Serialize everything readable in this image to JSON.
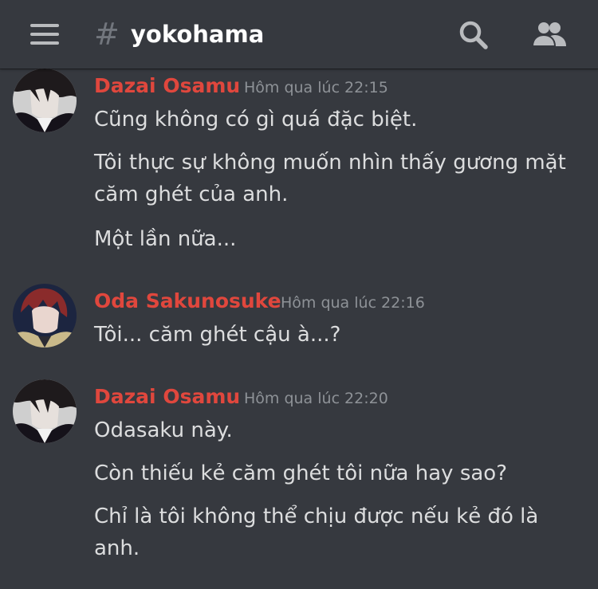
{
  "header": {
    "menu_icon": "hamburger-menu-icon",
    "hash_symbol": "#",
    "channel_name": "yokohama",
    "search_icon": "search-icon",
    "members_icon": "members-icon"
  },
  "colors": {
    "background": "#36393f",
    "username": "#e0473d",
    "timestamp": "#8e9297",
    "message_text": "#dcddde",
    "header_icon": "#b9bbbe"
  },
  "messages": [
    {
      "author": "Dazai Osamu",
      "time": "Hôm qua lúc 22:15",
      "lines": [
        "Cũng không có gì quá đặc biệt.",
        "Tôi thực sự không muốn nhìn thấy gương mặt căm ghét của anh.",
        "Một lần nữa..."
      ]
    },
    {
      "author": "Oda Sakunosuke",
      "time": "Hôm qua lúc 22:16",
      "lines": [
        "Tôi... căm ghét cậu à...?"
      ]
    },
    {
      "author": "Dazai Osamu",
      "time": "Hôm qua lúc 22:20",
      "lines": [
        "Odasaku này.",
        "Còn thiếu kẻ căm ghét tôi nữa hay sao?",
        "Chỉ là tôi không thể chịu được nếu kẻ đó là anh."
      ]
    }
  ]
}
